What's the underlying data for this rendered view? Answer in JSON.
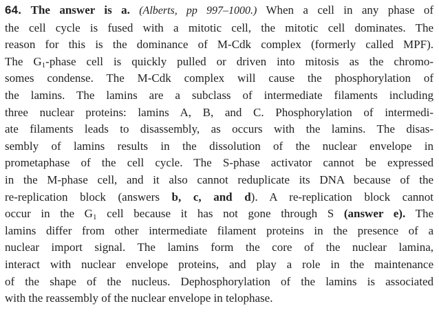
{
  "question_number": "64.",
  "answer_heading": "The answer is a.",
  "citation": "(Alberts, pp 997–1000.)",
  "lines": {
    "l1": "When a cell in any phase of",
    "l2": "the cell cycle is fused with a mitotic cell, the mitotic cell dominates. The",
    "l3": "reason for this is the dominance of M-Cdk complex (formerly called MPF).",
    "l4a": "The G",
    "l4sub": "1",
    "l4b": "-phase cell is quickly pulled or driven into mitosis as the chromo-",
    "l5": "somes condense. The M-Cdk complex will cause the phosphorylation of",
    "l6": "the lamins. The lamins are a subclass of intermediate filaments including",
    "l7": "three nuclear proteins: lamins A, B, and C. Phosphorylation of intermedi-",
    "l8": "ate filaments leads to disassembly, as occurs with the lamins. The disas-",
    "l9": "sembly of lamins results in the dissolution of the nuclear envelope in",
    "l10": "prometaphase of the cell cycle. The S-phase activator cannot be expressed",
    "l11": "in the M-phase cell, and it also cannot reduplicate its DNA because of the",
    "l12a": "re-replication block (answers ",
    "l12b": "b, c, and d",
    "l12c": "). A re-replication block cannot",
    "l13a": "occur in the G",
    "l13sub": "1",
    "l13b": " cell because it has not gone through S ",
    "l13c": "(answer e).",
    "l13d": " The",
    "l14": "lamins differ from other intermediate filament proteins in the presence of a",
    "l15": "nuclear import signal. The lamins form the core of the nuclear lamina,",
    "l16": "interact with nuclear envelope proteins, and play a role in the maintenance",
    "l17": "of the shape of the nucleus. Dephosphorylation of the lamins is associated",
    "l18": "with the reassembly of the nuclear envelope in telophase."
  }
}
